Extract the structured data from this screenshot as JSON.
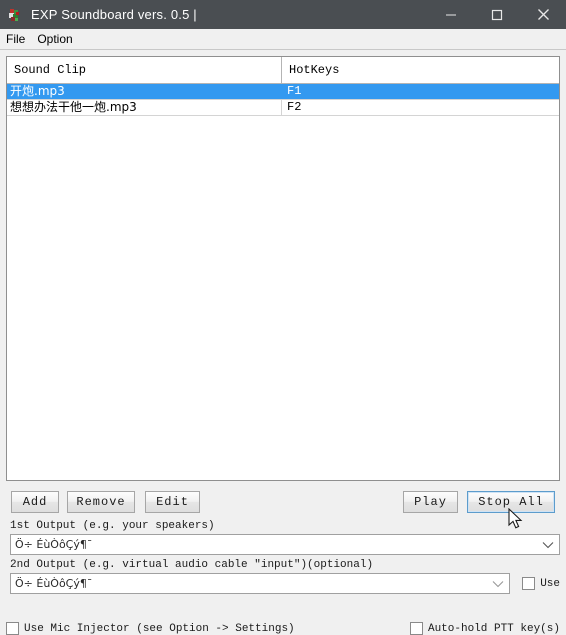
{
  "window": {
    "title": "EXP Soundboard vers. 0.5 |",
    "icon": "app-icon",
    "controls": {
      "minimize": "minimize-icon",
      "maximize": "maximize-icon",
      "close": "close-icon"
    }
  },
  "menu": {
    "items": [
      {
        "label": "File"
      },
      {
        "label": "Option"
      }
    ]
  },
  "table": {
    "columns": [
      {
        "label": "Sound Clip"
      },
      {
        "label": "HotKeys"
      }
    ],
    "rows": [
      {
        "clip": "开炮.mp3",
        "hotkey": "F1",
        "selected": true
      },
      {
        "clip": "想想办法干他一炮.mp3",
        "hotkey": "F2",
        "selected": false
      }
    ]
  },
  "buttons": {
    "add": "Add",
    "remove": "Remove",
    "edit": "Edit",
    "play": "Play",
    "stop_all": "Stop All"
  },
  "outputs": {
    "first_label": "1st Output (e.g. your speakers)",
    "first_value": "Ö÷ ÉùÒôÇý¶¯",
    "second_label": "2nd Output (e.g. virtual audio cable \"input\")(optional)",
    "second_value": "Ö÷ ÉùÒôÇý¶¯",
    "use_label": "Use"
  },
  "footer": {
    "mic_injector_label": "Use Mic Injector (see Option -> Settings)",
    "auto_hold_label": "Auto-hold PTT key(s)"
  },
  "colors": {
    "titlebar": "#4a4e52",
    "selection": "#3399f0",
    "window_bg": "#f0f0f0",
    "focus_border": "#5c9ccc"
  }
}
